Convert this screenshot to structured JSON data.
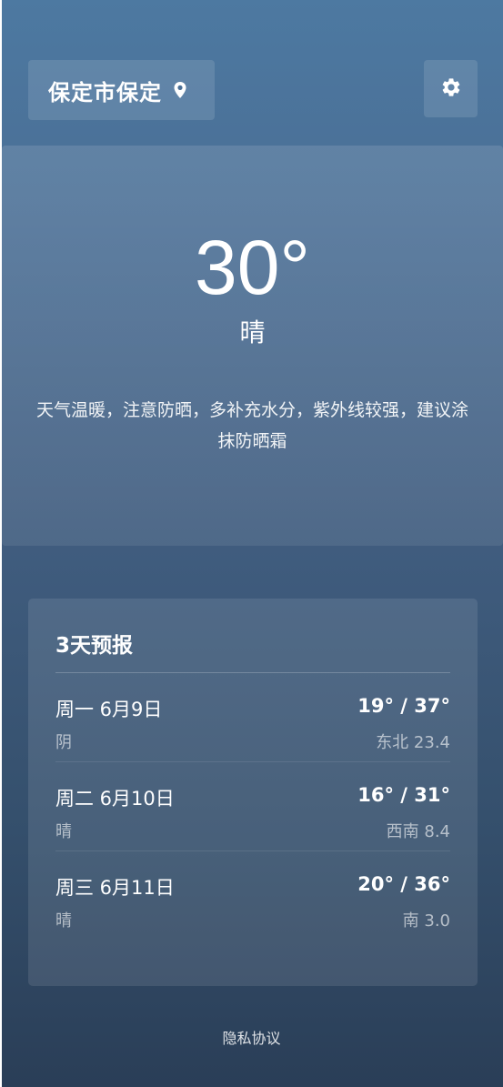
{
  "header": {
    "location": "保定市保定",
    "location_icon": "map-pin-icon",
    "settings_icon": "gear-icon"
  },
  "current": {
    "temperature": "30°",
    "condition": "晴",
    "tip": "天气温暖，注意防晒，多补充水分，紫外线较强，建议涂抹防晒霜"
  },
  "forecast": {
    "title": "3天预报",
    "days": [
      {
        "date": "周一 6月9日",
        "condition": "阴",
        "temp_range": "19° / 37°",
        "wind": "东北 23.4"
      },
      {
        "date": "周二 6月10日",
        "condition": "晴",
        "temp_range": "16° / 31°",
        "wind": "西南 8.4"
      },
      {
        "date": "周三 6月11日",
        "condition": "晴",
        "temp_range": "20° / 36°",
        "wind": "南 3.0"
      }
    ]
  },
  "footer": {
    "privacy_label": "隐私协议"
  }
}
